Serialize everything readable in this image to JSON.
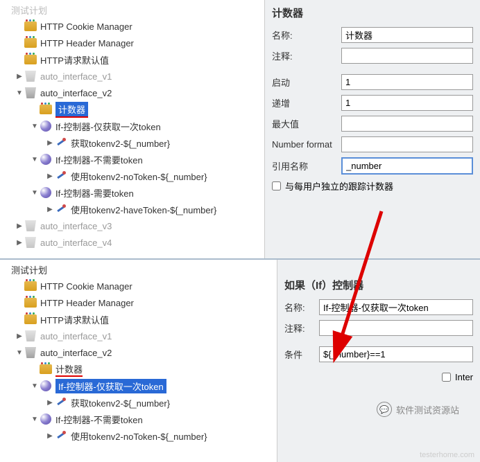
{
  "top": {
    "tree": {
      "header0": "测试计划",
      "http_cookie": "HTTP Cookie Manager",
      "http_header": "HTTP Header Manager",
      "http_default": "HTTP请求默认值",
      "auto_v1": "auto_interface_v1",
      "auto_v2": "auto_interface_v2",
      "counter": "计数器",
      "if_once": "If-控制器-仅获取一次token",
      "get_token": "获取tokenv2-${_number}",
      "if_no": "If-控制器-不需要token",
      "use_no": "使用tokenv2-noToken-${_number}",
      "if_need": "If-控制器-需要token",
      "use_have": "使用tokenv2-haveToken-${_number}",
      "auto_v3": "auto_interface_v3",
      "auto_v4": "auto_interface_v4"
    },
    "panel": {
      "title": "计数器",
      "name_label": "名称:",
      "name_val": "计数器",
      "comment_label": "注释:",
      "comment_val": "",
      "start_label": "启动",
      "start_val": "1",
      "incr_label": "递增",
      "incr_val": "1",
      "max_label": "最大值",
      "max_val": "",
      "numfmt_label": "Number format",
      "numfmt_val": "",
      "refname_label": "引用名称",
      "refname_val": "_number",
      "cb_peruser": "与每用户独立的跟踪计数器"
    }
  },
  "bottom": {
    "tree": {
      "plan": "测试计划",
      "http_cookie": "HTTP Cookie Manager",
      "http_header": "HTTP Header Manager",
      "http_default": "HTTP请求默认值",
      "auto_v1": "auto_interface_v1",
      "auto_v2": "auto_interface_v2",
      "counter": "计数器",
      "if_once": "If-控制器-仅获取一次token",
      "get_token": "获取tokenv2-${_number}",
      "if_no": "If-控制器-不需要token",
      "use_no": "使用tokenv2-noToken-${_number}"
    },
    "panel": {
      "title": "如果（If）控制器",
      "name_label": "名称:",
      "name_val": "If-控制器-仅获取一次token",
      "comment_label": "注释:",
      "comment_val": "",
      "cond_label": "条件",
      "cond_val": "${_number}==1",
      "cb_inter": "Inter"
    }
  },
  "wechat": "软件测试资源站",
  "watermark": "testerhome.com"
}
